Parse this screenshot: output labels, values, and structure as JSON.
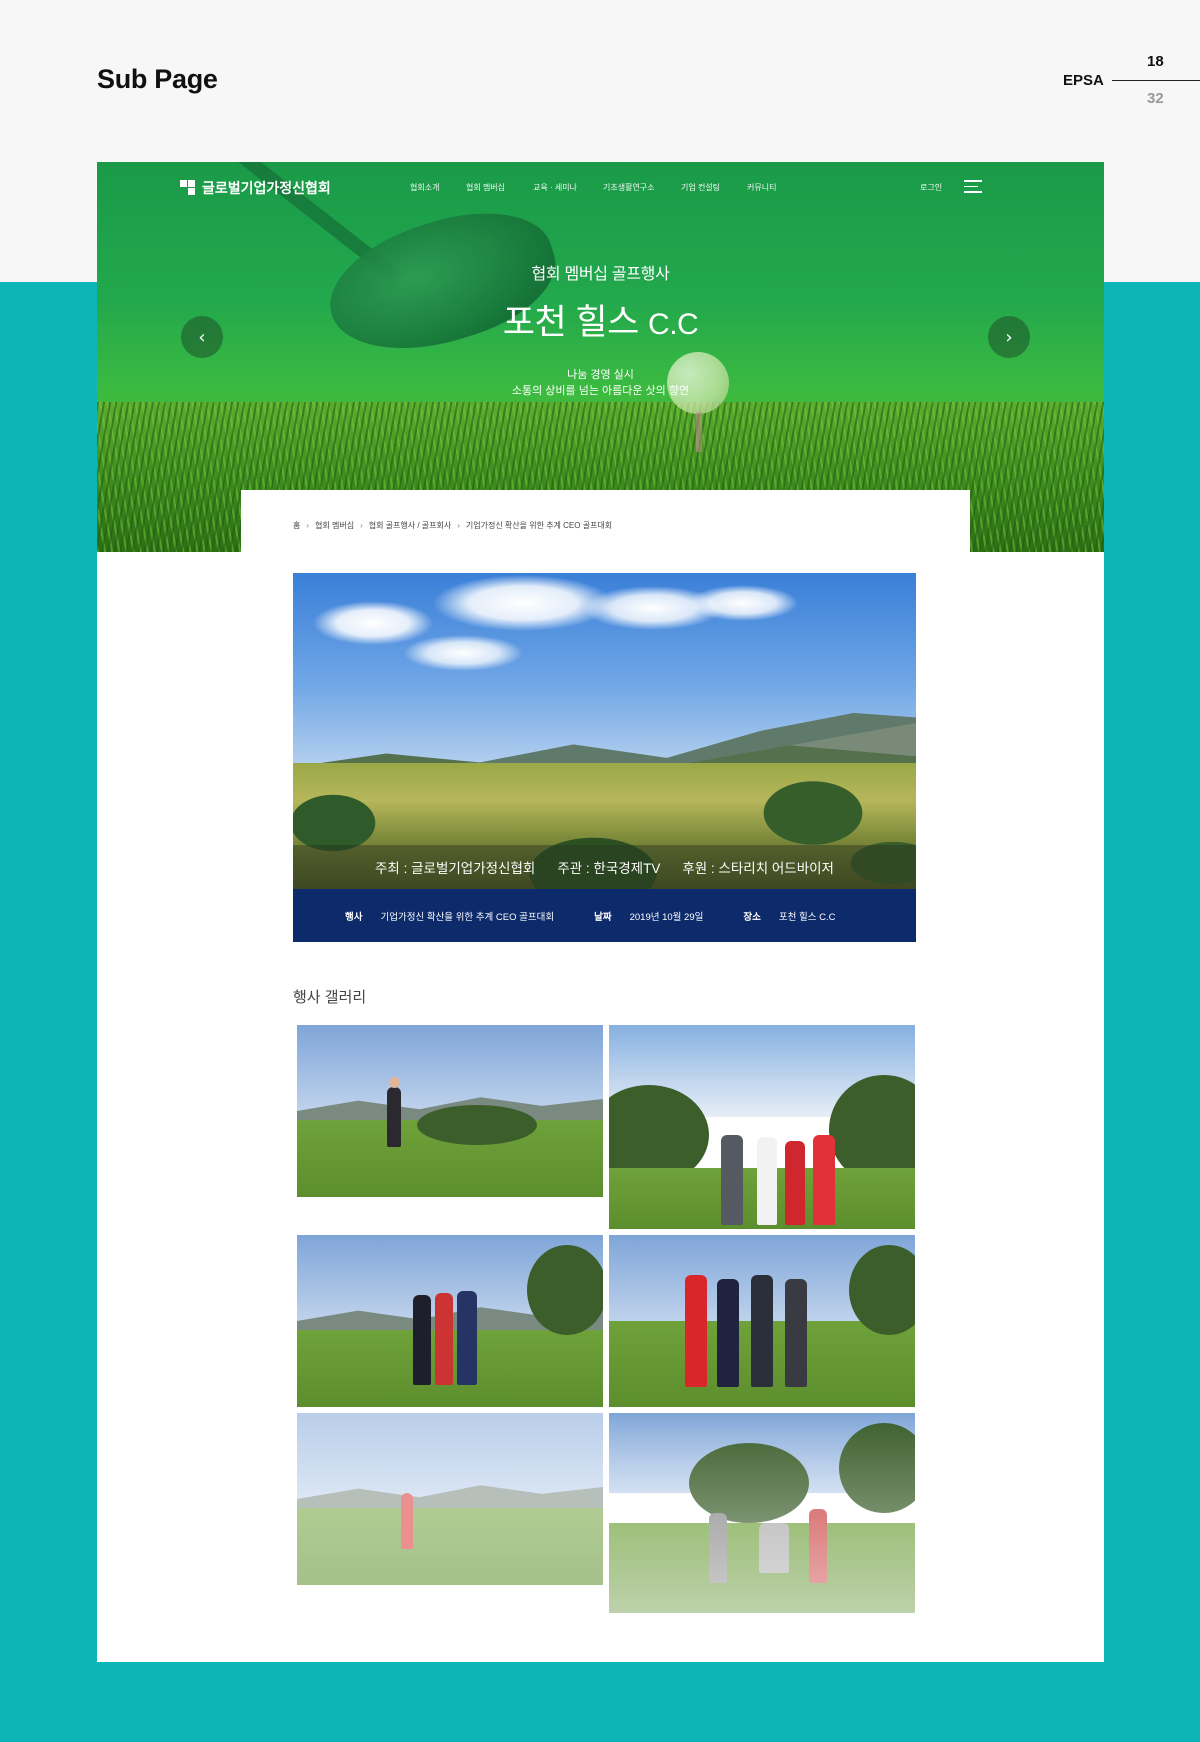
{
  "presentation": {
    "title": "Sub Page",
    "brand": "EPSA",
    "page_current": "18",
    "page_total": "32"
  },
  "site": {
    "logo_text": "글로벌기업가정신협회",
    "nav": [
      "협회소개",
      "협회 멤버십",
      "교육 · 세미나",
      "기초생활연구소",
      "기업 컨설팅",
      "커뮤니티"
    ],
    "login": "로그인",
    "hero": {
      "subtitle": "협회 멤버십 골프행사",
      "title_main": "포천 힐스",
      "title_suffix": "C.C",
      "desc_line1": "나눔 경영 실시",
      "desc_line2": "소통의 상비를 넘는 아름다운 삿의 향연"
    },
    "breadcrumb": [
      "홈",
      "협회 멤버십",
      "협회 골프행사 / 골프회사",
      "기업가정신 확산을 위한 추계 CEO 골프대회"
    ],
    "photo_caption": {
      "host": "주최 : 글로벌기업가정신협회",
      "organizer": "주관 : 한국경제TV",
      "sponsor": "후원 : 스타리치 어드바이저"
    },
    "event_info": {
      "event_label": "행사",
      "event_value": "기업가정신 확산을 위한 추계 CEO 골프대회",
      "date_label": "날짜",
      "date_value": "2019년 10월 29일",
      "place_label": "장소",
      "place_value": "포천 힐스 C.C"
    },
    "gallery_title": "행사 갤러리"
  },
  "colors": {
    "teal_bg": "#0bb5b8",
    "hero_green": "#22a84d",
    "event_bar": "#0d2a6b"
  }
}
